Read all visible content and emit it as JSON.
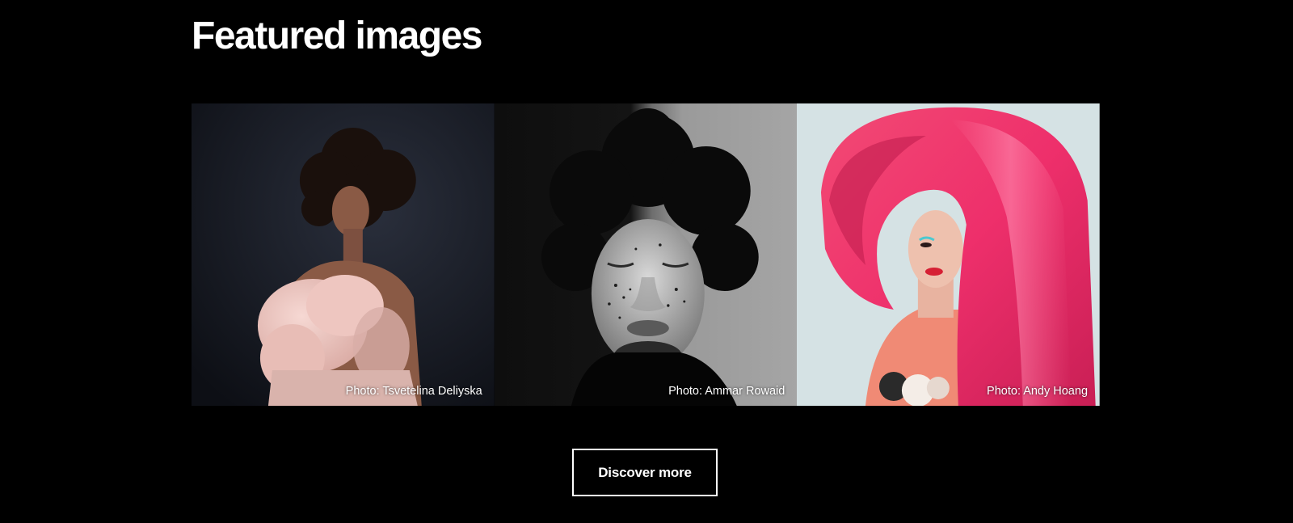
{
  "section": {
    "title": "Featured images"
  },
  "gallery": {
    "items": [
      {
        "caption": "Photo: Tsvetelina Deliyska"
      },
      {
        "caption": "Photo: Ammar Rowaid"
      },
      {
        "caption": "Photo: Andy Hoang"
      }
    ]
  },
  "cta": {
    "label": "Discover more"
  },
  "colors": {
    "background": "#000000",
    "text": "#ffffff",
    "accent_pink": "#f0336f"
  }
}
